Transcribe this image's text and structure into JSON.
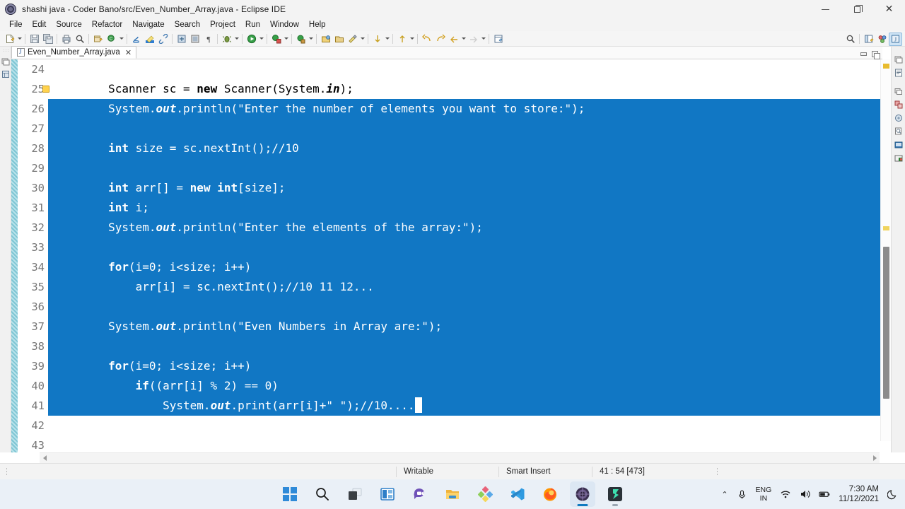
{
  "window": {
    "title": "shashi java - Coder Bano/src/Even_Number_Array.java - Eclipse IDE",
    "app_icon": "eclipse-icon",
    "controls": {
      "minimize": "minimize-icon",
      "restore": "restore-icon",
      "close": "close-icon"
    }
  },
  "menubar": {
    "items": [
      {
        "label": "File"
      },
      {
        "label": "Edit"
      },
      {
        "label": "Source"
      },
      {
        "label": "Refactor"
      },
      {
        "label": "Navigate"
      },
      {
        "label": "Search"
      },
      {
        "label": "Project"
      },
      {
        "label": "Run"
      },
      {
        "label": "Window"
      },
      {
        "label": "Help"
      }
    ]
  },
  "toolbar": {
    "groups": [
      {
        "icons": [
          "new-file-icon",
          "dropdown-arrow"
        ]
      },
      {
        "icons": [
          "save-icon",
          "save-all-icon"
        ]
      },
      {
        "icons": [
          "print-icon",
          "search-icon"
        ]
      },
      {
        "icons": [
          "new-java-package-icon",
          "new-java-class-icon",
          "dropdown-arrow"
        ]
      },
      {
        "icons": [
          "java-perspective-icon",
          "highlight-icon",
          "link-icon"
        ]
      },
      {
        "icons": [
          "build-icon",
          "console-icon",
          "pilcrow-icon"
        ]
      },
      {
        "icons": [
          "debug-icon",
          "dropdown-arrow"
        ]
      },
      {
        "icons": [
          "run-icon",
          "dropdown-arrow"
        ]
      },
      {
        "icons": [
          "coverage-icon",
          "dropdown-arrow"
        ]
      },
      {
        "icons": [
          "external-tools-icon",
          "dropdown-arrow"
        ]
      },
      {
        "icons": [
          "open-type-icon",
          "open-task-icon",
          "search-ref-icon",
          "dropdown-arrow"
        ]
      },
      {
        "icons": [
          "next-annotation-icon",
          "dropdown-arrow"
        ]
      },
      {
        "icons": [
          "prev-annotation-icon",
          "dropdown-arrow"
        ]
      },
      {
        "icons": [
          "back-icon",
          "forward-icon",
          "undo-nav-icon",
          "dropdown-arrow",
          "redo-nav-icon",
          "dropdown-arrow"
        ]
      },
      {
        "icons": [
          "new-window-icon"
        ]
      }
    ],
    "right_icons": [
      "quick-access-search-icon",
      "open-perspective-icon",
      "java-ee-perspective-icon",
      "java-perspective-active-icon"
    ]
  },
  "editor_tab": {
    "filename": "Even_Number_Array.java",
    "file_icon": "java-file-icon",
    "close_icon": "close-icon",
    "minimize_icon": "minimize-view-icon",
    "maximize_icon": "maximize-view-icon"
  },
  "left_bar": {
    "icons": [
      "restore-view-icon",
      "package-explorer-icon"
    ]
  },
  "right_bar": {
    "icons": [
      "restore-view-icon",
      "outline-view-icon",
      "task-list-icon",
      "problems-view-icon",
      "javadoc-view-icon",
      "declaration-view-icon",
      "console-view-icon",
      "terminal-view-icon"
    ]
  },
  "editor": {
    "first_line": 24,
    "font_size_px": 16,
    "selection_color": "#1177c4",
    "selection_text_color": "#ffffff",
    "caret_line": 41,
    "lines": [
      {
        "num": 24,
        "selected": "none",
        "segments": []
      },
      {
        "num": 25,
        "selected": "partial",
        "indent": 8,
        "warn_marker": true,
        "segments": [
          {
            "t": "Scanner sc = ",
            "s": "plain"
          },
          {
            "t": "new",
            "s": "kw"
          },
          {
            "t": " Scanner(System.",
            "s": "plain"
          },
          {
            "t": "in",
            "s": "fld"
          },
          {
            "t": ");",
            "s": "plain"
          }
        ]
      },
      {
        "num": 26,
        "selected": "full",
        "indent": 8,
        "segments": [
          {
            "t": "System.",
            "s": "plain"
          },
          {
            "t": "out",
            "s": "fld"
          },
          {
            "t": ".println(\"Enter the number of elements you want to store:\");",
            "s": "plain"
          }
        ]
      },
      {
        "num": 27,
        "selected": "full",
        "indent": 0,
        "segments": []
      },
      {
        "num": 28,
        "selected": "full",
        "indent": 8,
        "segments": [
          {
            "t": "int",
            "s": "kw"
          },
          {
            "t": " size = sc.nextInt();//10",
            "s": "plain"
          }
        ]
      },
      {
        "num": 29,
        "selected": "full",
        "indent": 0,
        "segments": []
      },
      {
        "num": 30,
        "selected": "full",
        "indent": 8,
        "segments": [
          {
            "t": "int",
            "s": "kw"
          },
          {
            "t": " arr[] = ",
            "s": "plain"
          },
          {
            "t": "new int",
            "s": "kw"
          },
          {
            "t": "[size];",
            "s": "plain"
          }
        ]
      },
      {
        "num": 31,
        "selected": "full",
        "indent": 8,
        "segments": [
          {
            "t": "int",
            "s": "kw"
          },
          {
            "t": " i;",
            "s": "plain"
          }
        ]
      },
      {
        "num": 32,
        "selected": "full",
        "indent": 8,
        "segments": [
          {
            "t": "System.",
            "s": "plain"
          },
          {
            "t": "out",
            "s": "fld"
          },
          {
            "t": ".println(\"Enter the elements of the array:\");",
            "s": "plain"
          }
        ]
      },
      {
        "num": 33,
        "selected": "full",
        "indent": 0,
        "segments": []
      },
      {
        "num": 34,
        "selected": "full",
        "indent": 8,
        "segments": [
          {
            "t": "for",
            "s": "kw"
          },
          {
            "t": "(i=0; i<size; i++)",
            "s": "plain"
          }
        ]
      },
      {
        "num": 35,
        "selected": "full",
        "indent": 8,
        "segments": [
          {
            "t": "    arr[i] = sc.nextInt();//10 11 12...",
            "s": "plain"
          }
        ]
      },
      {
        "num": 36,
        "selected": "full",
        "indent": 0,
        "segments": []
      },
      {
        "num": 37,
        "selected": "full",
        "indent": 8,
        "segments": [
          {
            "t": "System.",
            "s": "plain"
          },
          {
            "t": "out",
            "s": "fld"
          },
          {
            "t": ".println(\"Even Numbers in Array are:\");",
            "s": "plain"
          }
        ]
      },
      {
        "num": 38,
        "selected": "full",
        "indent": 0,
        "segments": []
      },
      {
        "num": 39,
        "selected": "full",
        "indent": 8,
        "segments": [
          {
            "t": "for",
            "s": "kw"
          },
          {
            "t": "(i=0; i<size; i++)",
            "s": "plain"
          }
        ]
      },
      {
        "num": 40,
        "selected": "full",
        "indent": 8,
        "segments": [
          {
            "t": "    ",
            "s": "plain"
          },
          {
            "t": "if",
            "s": "kw"
          },
          {
            "t": "((arr[i] % 2) == 0)",
            "s": "plain"
          }
        ]
      },
      {
        "num": 41,
        "selected": "caret",
        "indent": 8,
        "segments": [
          {
            "t": "        System.",
            "s": "plain"
          },
          {
            "t": "out",
            "s": "fld"
          },
          {
            "t": ".print(arr[i]+\" \");//10....",
            "s": "plain"
          }
        ]
      },
      {
        "num": 42,
        "selected": "none",
        "indent": 0,
        "segments": []
      },
      {
        "num": 43,
        "selected": "none",
        "indent": 0,
        "segments": []
      }
    ]
  },
  "statusbar": {
    "writable": "Writable",
    "insert_mode": "Smart Insert",
    "position": "41 : 54 [473]"
  },
  "taskbar": {
    "items": [
      {
        "name": "start-button",
        "icon": "windows-logo-icon",
        "active": false
      },
      {
        "name": "search-button",
        "icon": "search-icon",
        "active": false
      },
      {
        "name": "task-view-button",
        "icon": "task-view-icon",
        "active": false
      },
      {
        "name": "widgets-button",
        "icon": "widgets-icon",
        "active": false
      },
      {
        "name": "teams-chat-button",
        "icon": "chat-icon",
        "active": false
      },
      {
        "name": "file-explorer-button",
        "icon": "folder-icon",
        "active": false
      },
      {
        "name": "office-button",
        "icon": "office-icon",
        "active": false
      },
      {
        "name": "vscode-button",
        "icon": "vscode-icon",
        "active": false
      },
      {
        "name": "firefox-button",
        "icon": "firefox-icon",
        "active": false
      },
      {
        "name": "eclipse-button",
        "icon": "eclipse-icon",
        "active": true
      },
      {
        "name": "filmora-button",
        "icon": "filmora-icon",
        "active": false
      }
    ],
    "tray": {
      "chevron": "⌃",
      "mic_icon": "microphone-icon",
      "language_line1": "ENG",
      "language_line2": "IN",
      "wifi_icon": "wifi-icon",
      "volume_icon": "speaker-icon",
      "battery_icon": "battery-icon",
      "time": "7:30 AM",
      "date": "11/12/2021",
      "notification_icon": "moon-icon"
    }
  }
}
